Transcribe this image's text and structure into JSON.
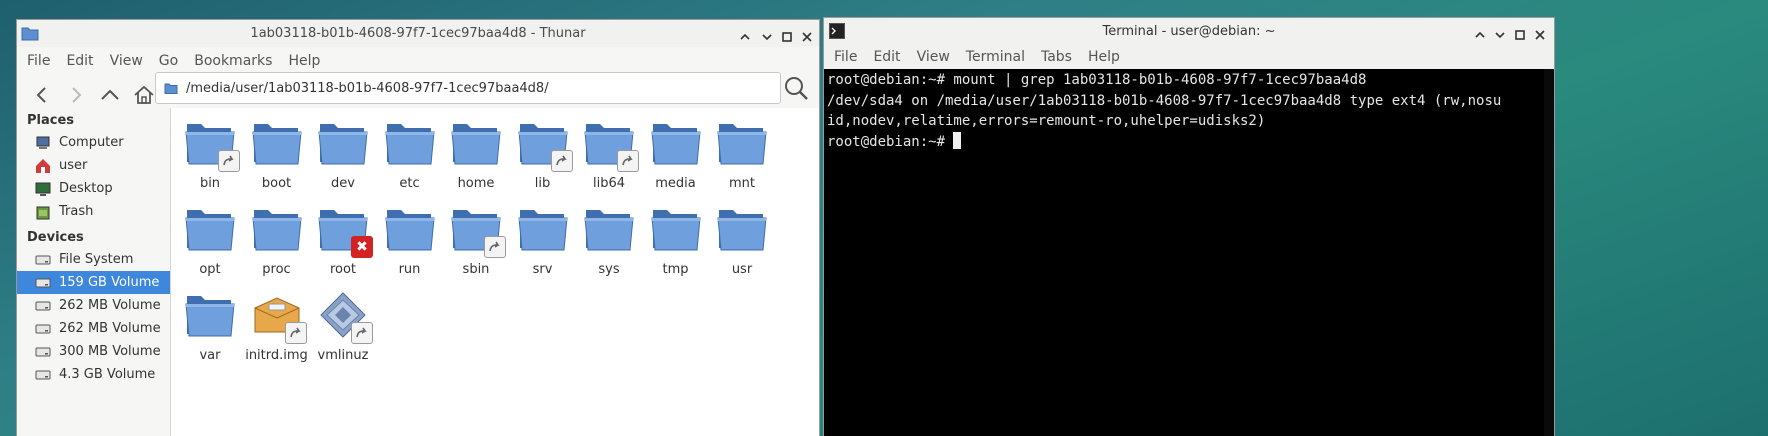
{
  "thunar": {
    "title": "1ab03118-b01b-4608-97f7-1cec97baa4d8 - Thunar",
    "menu": [
      "File",
      "Edit",
      "View",
      "Go",
      "Bookmarks",
      "Help"
    ],
    "location": "/media/user/1ab03118-b01b-4608-97f7-1cec97baa4d8/",
    "places_header": "Places",
    "places": [
      {
        "label": "Computer",
        "icon": "computer-icon"
      },
      {
        "label": "user",
        "icon": "home-icon"
      },
      {
        "label": "Desktop",
        "icon": "desktop-icon"
      },
      {
        "label": "Trash",
        "icon": "trash-icon"
      }
    ],
    "devices_header": "Devices",
    "devices": [
      {
        "label": "File System",
        "icon": "drive-icon"
      },
      {
        "label": "159 GB Volume",
        "icon": "drive-icon",
        "selected": true
      },
      {
        "label": "262 MB Volume",
        "icon": "drive-icon"
      },
      {
        "label": "262 MB Volume",
        "icon": "drive-icon"
      },
      {
        "label": "300 MB Volume",
        "icon": "drive-icon"
      },
      {
        "label": "4.3 GB Volume",
        "icon": "drive-icon"
      }
    ],
    "files": [
      {
        "name": "bin",
        "type": "folder",
        "badge": "link"
      },
      {
        "name": "boot",
        "type": "folder"
      },
      {
        "name": "dev",
        "type": "folder"
      },
      {
        "name": "etc",
        "type": "folder"
      },
      {
        "name": "home",
        "type": "folder"
      },
      {
        "name": "lib",
        "type": "folder",
        "badge": "link"
      },
      {
        "name": "lib64",
        "type": "folder",
        "badge": "link"
      },
      {
        "name": "media",
        "type": "folder"
      },
      {
        "name": "mnt",
        "type": "folder"
      },
      {
        "name": "opt",
        "type": "folder"
      },
      {
        "name": "proc",
        "type": "folder"
      },
      {
        "name": "root",
        "type": "folder",
        "badge": "x"
      },
      {
        "name": "run",
        "type": "folder"
      },
      {
        "name": "sbin",
        "type": "folder",
        "badge": "link"
      },
      {
        "name": "srv",
        "type": "folder"
      },
      {
        "name": "sys",
        "type": "folder"
      },
      {
        "name": "tmp",
        "type": "folder"
      },
      {
        "name": "usr",
        "type": "folder"
      },
      {
        "name": "var",
        "type": "folder"
      },
      {
        "name": "initrd.img",
        "type": "package",
        "badge": "link"
      },
      {
        "name": "vmlinuz",
        "type": "kernel",
        "badge": "link"
      }
    ]
  },
  "terminal": {
    "title": "Terminal - user@debian: ~",
    "menu": [
      "File",
      "Edit",
      "View",
      "Terminal",
      "Tabs",
      "Help"
    ],
    "lines": [
      "root@debian:~# mount | grep 1ab03118-b01b-4608-97f7-1cec97baa4d8",
      "/dev/sda4 on /media/user/1ab03118-b01b-4608-97f7-1cec97baa4d8 type ext4 (rw,nosu",
      "id,nodev,relatime,errors=remount-ro,uhelper=udisks2)"
    ],
    "prompt": "root@debian:~# "
  },
  "colors": {
    "selection": "#3d87dc",
    "folder": "#5b8fcf",
    "terminal_bg": "#000000"
  }
}
